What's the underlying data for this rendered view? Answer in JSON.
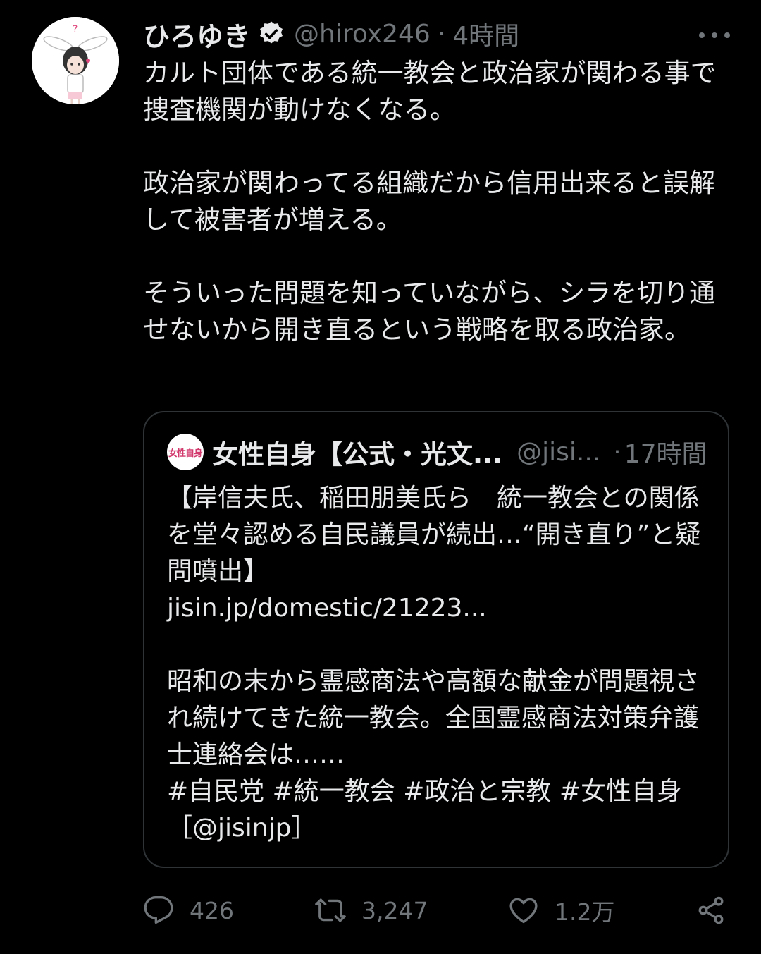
{
  "tweet": {
    "author": {
      "display_name": "ひろゆき",
      "handle": "@hirox246",
      "verified_icon": "verified-badge-icon"
    },
    "separator": "·",
    "time": "4時間",
    "body": [
      "カルト団体である統一教会と政治家が関わる事で捜査機関が動けなくなる。",
      "政治家が関わってる組織だから信用出来ると誤解して被害者が増える。",
      "そういった問題を知っていながら、シラを切り通せないから開き直るという戦略を取る政治家。"
    ]
  },
  "quote": {
    "avatar_text": "女性自身",
    "display_name": "女性自身【公式・光文...",
    "handle": "@jisi...",
    "separator": "·",
    "time": "17時間",
    "headline": "【岸信夫氏、稲田朋美氏ら　統一教会との関係を堂々認める自民議員が続出…“開き直り”と疑問噴出】",
    "link": "jisin.jp/domestic/21223...",
    "excerpt": "昭和の末から霊感商法や高額な献金が問題視され続けてきた統一教会。全国霊感商法対策弁護士連絡会は……",
    "hashtags": " #自民党 #統一教会 #政治と宗教 #女性自身",
    "mention": "［@jisinjp］"
  },
  "actions": {
    "reply_count": "426",
    "retweet_count": "3,247",
    "like_count": "1.2万"
  },
  "colors": {
    "background": "#000000",
    "text": "#e7e9ea",
    "secondary": "#71767b",
    "border": "#2f3336"
  }
}
